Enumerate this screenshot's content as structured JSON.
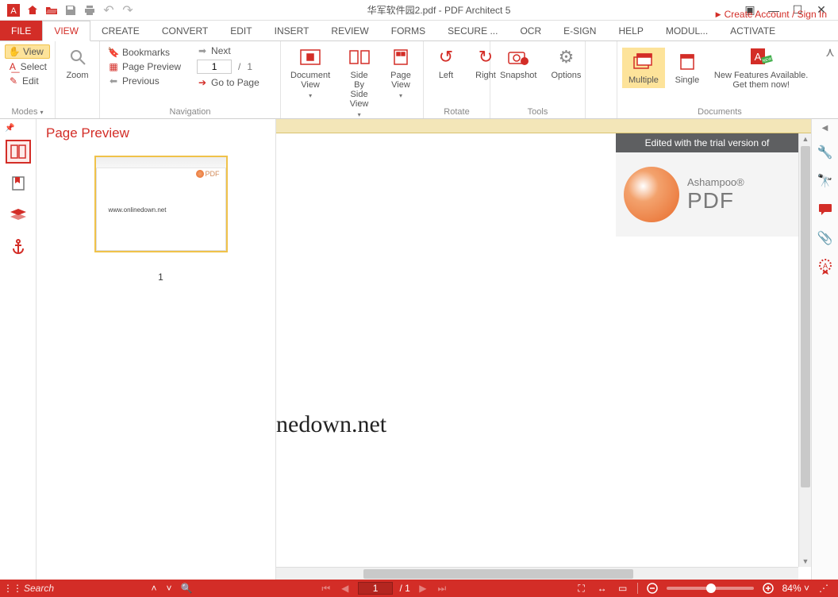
{
  "title_bar": {
    "document_name": "华军软件园2.pdf",
    "separator": "   -   ",
    "app_name": "PDF Architect 5"
  },
  "account_link": "Create Account / Sign In",
  "menu_tabs": {
    "file": "FILE",
    "view": "VIEW",
    "create": "CREATE",
    "convert": "CONVERT",
    "edit": "EDIT",
    "insert": "INSERT",
    "review": "REVIEW",
    "forms": "FORMS",
    "secure": "SECURE ...",
    "ocr": "OCR",
    "esign": "E-SIGN",
    "help": "HELP",
    "modul": "MODUL...",
    "activate": "ACTIVATE"
  },
  "ribbon": {
    "modes": {
      "label": "Modes",
      "view": "View",
      "select": "Select",
      "edit": "Edit"
    },
    "zoom": {
      "label": "Zoom",
      "btn": "Zoom"
    },
    "navigation": {
      "label": "Navigation",
      "bookmarks": "Bookmarks",
      "page_preview": "Page Preview",
      "previous": "Previous",
      "next": "Next",
      "page_value": "1",
      "page_sep": "/",
      "page_total": "1",
      "goto": "Go to Page"
    },
    "views": {
      "document_view": "Document View",
      "side_by_side": "Side By Side View",
      "page_view": "Page View"
    },
    "rotate": {
      "label": "Rotate",
      "left": "Left",
      "right": "Right"
    },
    "tools": {
      "label": "Tools",
      "snapshot": "Snapshot",
      "options": "Options"
    },
    "documents": {
      "label": "Documents",
      "multiple": "Multiple",
      "single": "Single",
      "new_features_line1": "New Features Available.",
      "new_features_line2": "Get them now!"
    }
  },
  "preview": {
    "title": "Page Preview",
    "thumb_text": "www.onlinedown.net",
    "thumb_logo": "PDF",
    "page_number": "1"
  },
  "doc": {
    "trial_banner": "Edited with the trial version of",
    "ashampoo_line1": "Ashampoo®",
    "ashampoo_line2": "PDF",
    "main_text": "nedown.net"
  },
  "status": {
    "search_placeholder": "Search",
    "page_current": "1",
    "page_sep": "/",
    "page_total": "1",
    "zoom_label": "84%"
  }
}
